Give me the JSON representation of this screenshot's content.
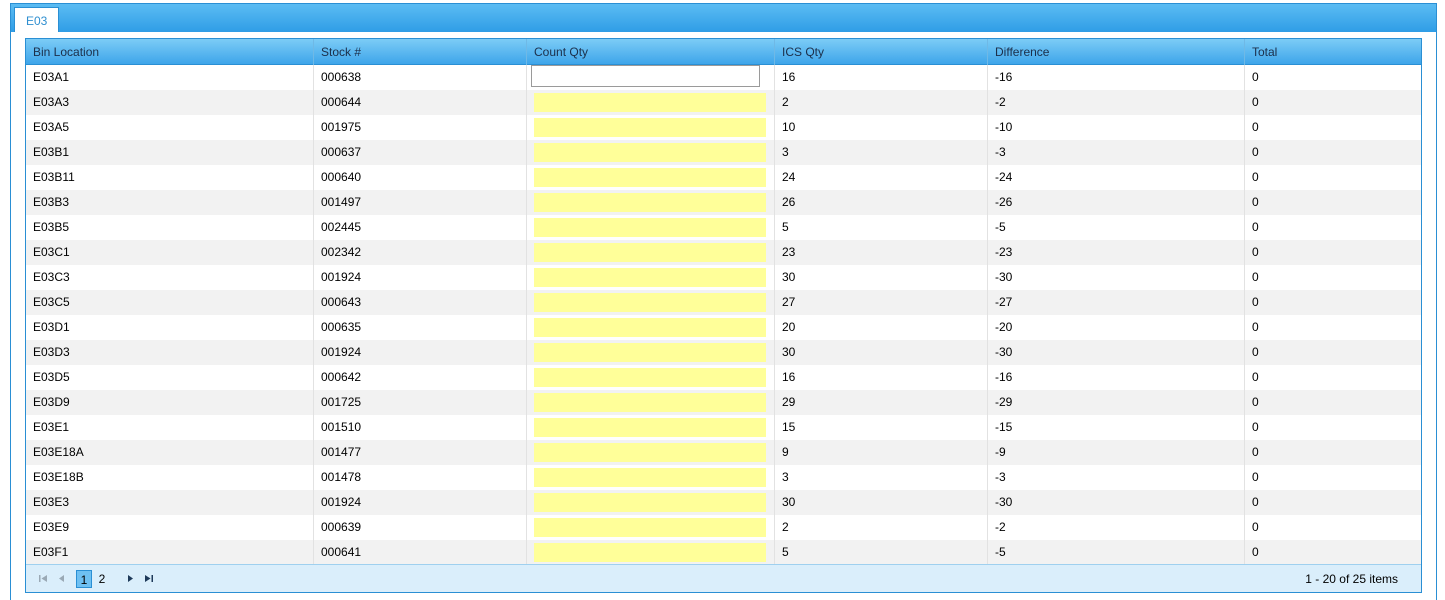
{
  "tab": {
    "label": "E03"
  },
  "columns": [
    "Bin Location",
    "Stock #",
    "Count Qty",
    "ICS Qty",
    "Difference",
    "Total"
  ],
  "rows": [
    {
      "bin": "E03A1",
      "stock": "000638",
      "count": "",
      "ics": "16",
      "diff": "-16",
      "total": "0"
    },
    {
      "bin": "E03A3",
      "stock": "000644",
      "count": "",
      "ics": "2",
      "diff": "-2",
      "total": "0"
    },
    {
      "bin": "E03A5",
      "stock": "001975",
      "count": "",
      "ics": "10",
      "diff": "-10",
      "total": "0"
    },
    {
      "bin": "E03B1",
      "stock": "000637",
      "count": "",
      "ics": "3",
      "diff": "-3",
      "total": "0"
    },
    {
      "bin": "E03B11",
      "stock": "000640",
      "count": "",
      "ics": "24",
      "diff": "-24",
      "total": "0"
    },
    {
      "bin": "E03B3",
      "stock": "001497",
      "count": "",
      "ics": "26",
      "diff": "-26",
      "total": "0"
    },
    {
      "bin": "E03B5",
      "stock": "002445",
      "count": "",
      "ics": "5",
      "diff": "-5",
      "total": "0"
    },
    {
      "bin": "E03C1",
      "stock": "002342",
      "count": "",
      "ics": "23",
      "diff": "-23",
      "total": "0"
    },
    {
      "bin": "E03C3",
      "stock": "001924",
      "count": "",
      "ics": "30",
      "diff": "-30",
      "total": "0"
    },
    {
      "bin": "E03C5",
      "stock": "000643",
      "count": "",
      "ics": "27",
      "diff": "-27",
      "total": "0"
    },
    {
      "bin": "E03D1",
      "stock": "000635",
      "count": "",
      "ics": "20",
      "diff": "-20",
      "total": "0"
    },
    {
      "bin": "E03D3",
      "stock": "001924",
      "count": "",
      "ics": "30",
      "diff": "-30",
      "total": "0"
    },
    {
      "bin": "E03D5",
      "stock": "000642",
      "count": "",
      "ics": "16",
      "diff": "-16",
      "total": "0"
    },
    {
      "bin": "E03D9",
      "stock": "001725",
      "count": "",
      "ics": "29",
      "diff": "-29",
      "total": "0"
    },
    {
      "bin": "E03E1",
      "stock": "001510",
      "count": "",
      "ics": "15",
      "diff": "-15",
      "total": "0"
    },
    {
      "bin": "E03E18A",
      "stock": "001477",
      "count": "",
      "ics": "9",
      "diff": "-9",
      "total": "0"
    },
    {
      "bin": "E03E18B",
      "stock": "001478",
      "count": "",
      "ics": "3",
      "diff": "-3",
      "total": "0"
    },
    {
      "bin": "E03E3",
      "stock": "001924",
      "count": "",
      "ics": "30",
      "diff": "-30",
      "total": "0"
    },
    {
      "bin": "E03E9",
      "stock": "000639",
      "count": "",
      "ics": "2",
      "diff": "-2",
      "total": "0"
    },
    {
      "bin": "E03F1",
      "stock": "000641",
      "count": "",
      "ics": "5",
      "diff": "-5",
      "total": "0"
    }
  ],
  "pager": {
    "pages": [
      "1",
      "2"
    ],
    "current_page": "1",
    "info": "1 - 20 of 25 items"
  },
  "colors": {
    "header_gradient_top": "#7cccf6",
    "header_gradient_bottom": "#3ea5ea",
    "count_input_bg": "#ffff99",
    "alt_row_bg": "#f2f2f2",
    "pager_bg": "#daeefb"
  },
  "icons": {
    "first": "first-page-icon",
    "prev": "prev-page-icon",
    "next": "next-page-icon",
    "last": "last-page-icon"
  }
}
